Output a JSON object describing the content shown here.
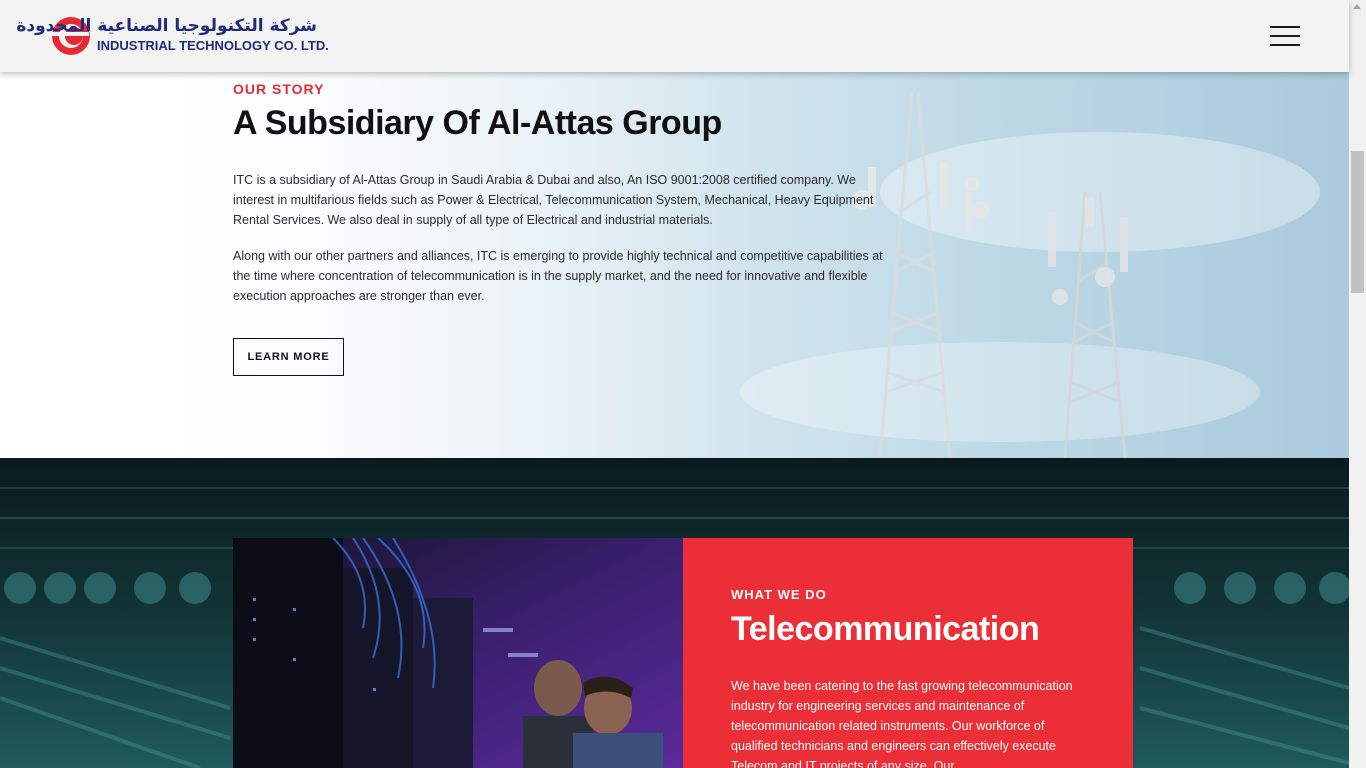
{
  "header": {
    "logo_arabic": "شركة التكنولوجيا الصناعية المحدودة",
    "logo_english": "INDUSTRIAL TECHNOLOGY CO. LTD.",
    "menu_icon": "hamburger-menu-icon"
  },
  "story": {
    "eyebrow": "OUR STORY",
    "title": "A Subsidiary Of Al-Attas Group",
    "paragraph_1": "ITC is a subsidiary of Al-Attas Group in Saudi Arabia & Dubai and also, An ISO 9001:2008 certified company. We interest in multifarious fields such as Power & Electrical, Telecommunication System, Mechanical, Heavy Equipment Rental Services. We also deal in supply of all type of Electrical and industrial materials.",
    "paragraph_2": "Along with our other partners and alliances, ITC is emerging to provide highly technical and competitive capabilities at the time where concentration of telecommunication is in the supply market, and the need for innovative and flexible execution approaches are stronger than ever.",
    "button_label": "LEARN MORE"
  },
  "services": {
    "eyebrow": "WHAT WE DO",
    "title": "Telecommunication",
    "body": "We have been catering to the fast growing telecommunication industry for engineering services and maintenance of telecommunication related instruments. Our workforce of qualified technicians and engineers can effectively execute Telecom and IT projects of any size. Our"
  },
  "colors": {
    "accent_red": "#e32b33",
    "panel_red": "#ec2f36",
    "brand_navy": "#1e2c7a",
    "header_bg": "#f3f3f3"
  }
}
